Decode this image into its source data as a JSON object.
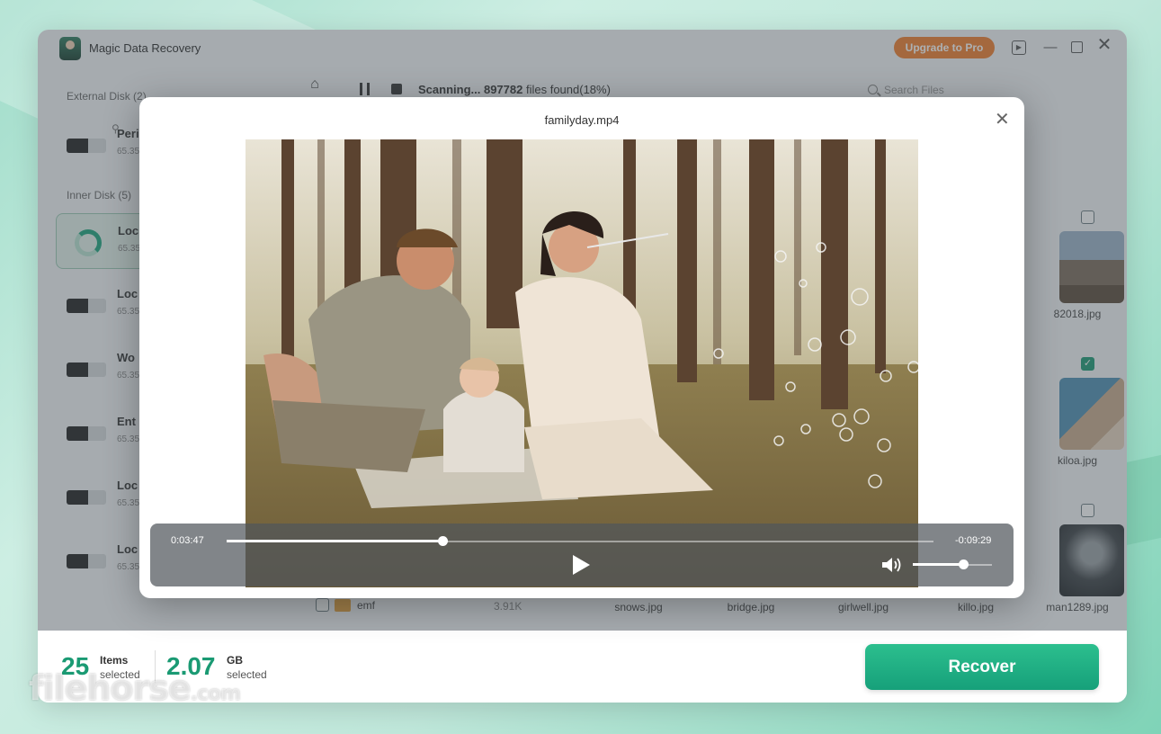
{
  "window": {
    "app_title": "Magic Data Recovery",
    "upgrade_label": "Upgrade to Pro"
  },
  "sidebar": {
    "external_label": "External Disk (2)",
    "inner_label": "Inner Disk (5)",
    "drives": [
      {
        "name": "Peri",
        "size": "65.35"
      },
      {
        "name": "Loc",
        "size": "65.35"
      },
      {
        "name": "Loc",
        "size": "65.35"
      },
      {
        "name": "Wo",
        "size": "65.35"
      },
      {
        "name": "Ent",
        "size": "65.35"
      },
      {
        "name": "Loc",
        "size": "65.35"
      },
      {
        "name": "Loc",
        "size": "65.35"
      }
    ]
  },
  "toolbar": {
    "scan_prefix": "Scanning...",
    "files_found": "897782",
    "files_suffix": "files found(18%)",
    "search_placeholder": "Search Files"
  },
  "grid": {
    "file_1": "82018.jpg",
    "file_2": "kiloa.jpg",
    "file_3": "man1289.jpg",
    "bottom_row": [
      "snows.jpg",
      "bridge.jpg",
      "girlwell.jpg",
      "killo.jpg"
    ]
  },
  "list_row": {
    "name": "emf",
    "size": "3.91K"
  },
  "preview": {
    "title": "familyday.mp4",
    "time_current": "0:03:47",
    "time_remaining": "-0:09:29",
    "progress": 0.306,
    "volume": 0.64
  },
  "footer": {
    "items_count": "25",
    "items_unit": "Items",
    "items_sub": "selected",
    "size_value": "2.07",
    "size_unit": "GB",
    "size_sub": "selected",
    "recover_label": "Recover"
  },
  "watermark": {
    "main": "filehorse",
    "suffix": ".com"
  },
  "colors": {
    "accent": "#1a9a73",
    "upgrade": "#f07c2a",
    "recover": "#22b183"
  }
}
